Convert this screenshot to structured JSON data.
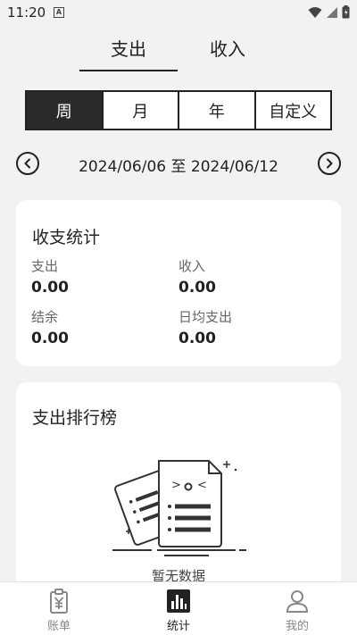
{
  "status_bar": {
    "time": "11:20"
  },
  "top_tabs": [
    {
      "label": "支出",
      "active": true
    },
    {
      "label": "收入",
      "active": false
    }
  ],
  "period_tabs": [
    {
      "label": "周",
      "active": true
    },
    {
      "label": "月",
      "active": false
    },
    {
      "label": "年",
      "active": false
    },
    {
      "label": "自定义",
      "active": false
    }
  ],
  "date_range": {
    "text": "2024/06/06 至 2024/06/12"
  },
  "stats_card": {
    "title": "收支统计",
    "expense": {
      "label": "支出",
      "value": "0.00"
    },
    "income": {
      "label": "收入",
      "value": "0.00"
    },
    "balance": {
      "label": "结余",
      "value": "0.00"
    },
    "daily_expense": {
      "label": "日均支出",
      "value": "0.00"
    }
  },
  "ranking_card": {
    "title": "支出排行榜",
    "empty_text": "暂无数据"
  },
  "bottom_nav": [
    {
      "label": "账单",
      "icon": "bill-icon",
      "active": false
    },
    {
      "label": "统计",
      "icon": "chart-icon",
      "active": true
    },
    {
      "label": "我的",
      "icon": "user-icon",
      "active": false
    }
  ]
}
